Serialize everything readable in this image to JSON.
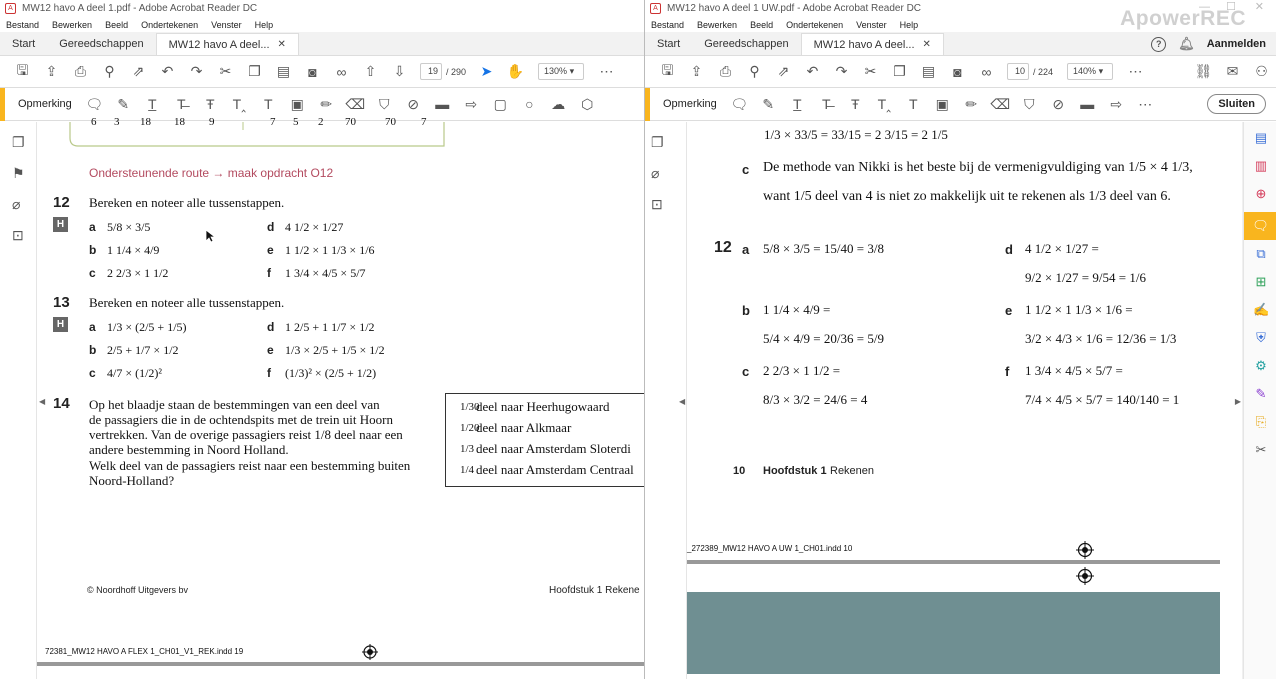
{
  "left": {
    "title": "MW12 havo A deel 1.pdf - Adobe Acrobat Reader DC",
    "menu": [
      "Bestand",
      "Bewerken",
      "Beeld",
      "Ondertekenen",
      "Venster",
      "Help"
    ],
    "tabs": {
      "start": "Start",
      "tools": "Gereedschappen",
      "doc": "MW12 havo A deel..."
    },
    "page_current": "19",
    "page_total": "/ 290",
    "zoom": "130%",
    "annot_label": "Opmerking",
    "table_row": [
      "6",
      "3",
      "18",
      "18",
      "9",
      "7",
      "5",
      "2",
      "70",
      "70",
      "7"
    ],
    "route": "Ondersteunende route → maak opdracht O12",
    "q12": {
      "num": "12",
      "prompt": "Bereken en noteer alle tussenstappen.",
      "badge": "H",
      "items": [
        {
          "letter": "a",
          "expr": "5/8 × 3/5"
        },
        {
          "letter": "b",
          "expr": "1 1/4 × 4/9"
        },
        {
          "letter": "c",
          "expr": "2 2/3 × 1 1/2"
        },
        {
          "letter": "d",
          "expr": "4 1/2 × 1/27"
        },
        {
          "letter": "e",
          "expr": "1 1/2 × 1 1/3 × 1/6"
        },
        {
          "letter": "f",
          "expr": "1 3/4 × 4/5 × 5/7"
        }
      ]
    },
    "q13": {
      "num": "13",
      "prompt": "Bereken en noteer alle tussenstappen.",
      "badge": "H",
      "items": [
        {
          "letter": "a",
          "expr": "1/3 × (2/5 + 1/5)"
        },
        {
          "letter": "b",
          "expr": "2/5 + 1/7 × 1/2"
        },
        {
          "letter": "c",
          "expr": "4/7 × (1/2)²"
        },
        {
          "letter": "d",
          "expr": "1 2/5 + 1 1/7 × 1/2"
        },
        {
          "letter": "e",
          "expr": "1/3 × 2/5 + 1/5 × 1/2"
        },
        {
          "letter": "f",
          "expr": "(1/3)² × (2/5 + 1/2)"
        }
      ]
    },
    "q14": {
      "num": "14",
      "lines": [
        "Op het blaadje staan de bestemmingen van een deel van",
        "de passagiers die in de ochtendspits met de trein uit Hoorn",
        "vertrekken. Van de overige passagiers reist 1/8 deel naar een",
        "andere bestemming in Noord Holland.",
        "Welk deel van de passagiers reist naar een bestemming buiten",
        "Noord-Holland?"
      ],
      "box": [
        {
          "frac": "1/30",
          "text": "deel naar Heerhugowaard"
        },
        {
          "frac": "1/20",
          "text": "deel naar Alkmaar"
        },
        {
          "frac": "1/3",
          "text": "deel naar Amsterdam Sloterdi"
        },
        {
          "frac": "1/4",
          "text": "deel naar Amsterdam Centraal"
        }
      ]
    },
    "footer_left": "© Noordhoff Uitgevers bv",
    "footer_right": "Hoofdstuk 1 Rekene",
    "crop_text": "72381_MW12 HAVO A FLEX 1_CH01_V1_REK.indd   19"
  },
  "right": {
    "title": "MW12 havo A deel 1 UW.pdf - Adobe Acrobat Reader DC",
    "menu": [
      "Bestand",
      "Bewerken",
      "Beeld",
      "Ondertekenen",
      "Venster",
      "Help"
    ],
    "tabs": {
      "start": "Start",
      "tools": "Gereedschappen",
      "doc": "MW12 havo A deel..."
    },
    "signin": "Aanmelden",
    "page_current": "10",
    "page_total": "/ 224",
    "zoom": "140%",
    "annot_label": "Opmerking",
    "close_label": "Sluiten",
    "top_line": "1/3 × 33/5 = 33/15 = 2 3/15 = 2 1/5",
    "c_letter": "c",
    "c_line1": "De methode van Nikki is het beste bij de vermenigvuldiging van 1/5 × 4 1/3,",
    "c_line2": "want 1/5 deel van 4 is niet zo makkelijk uit te rekenen als 1/3 deel van 6.",
    "q12_num": "12",
    "answers": [
      {
        "letter": "a",
        "q": "5/8 × 3/5 = 15/40 = 3/8",
        "a": ""
      },
      {
        "letter": "b",
        "q": "1 1/4 × 4/9 =",
        "a": "5/4 × 4/9 = 20/36 = 5/9"
      },
      {
        "letter": "c",
        "q": "2 2/3 × 1 1/2 =",
        "a": "8/3 × 3/2 = 24/6 = 4"
      },
      {
        "letter": "d",
        "q": "4 1/2 × 1/27 =",
        "a": "9/2 × 1/27 = 9/54 = 1/6"
      },
      {
        "letter": "e",
        "q": "1 1/2 × 1 1/3 × 1/6 =",
        "a": "3/2 × 4/3 × 1/6 = 12/36 = 1/3"
      },
      {
        "letter": "f",
        "q": "1 3/4 × 4/5 × 5/7 =",
        "a": "7/4 × 4/5 × 5/7 = 140/140 = 1"
      }
    ],
    "page_num": "10",
    "chapter_bold": "Hoofdstuk 1",
    "chapter_rest": "Rekenen",
    "crop_text": "_272389_MW12 HAVO A UW 1_CH01.indd   10",
    "band_color": "#6f8f92"
  },
  "watermark": "ApowerREC"
}
